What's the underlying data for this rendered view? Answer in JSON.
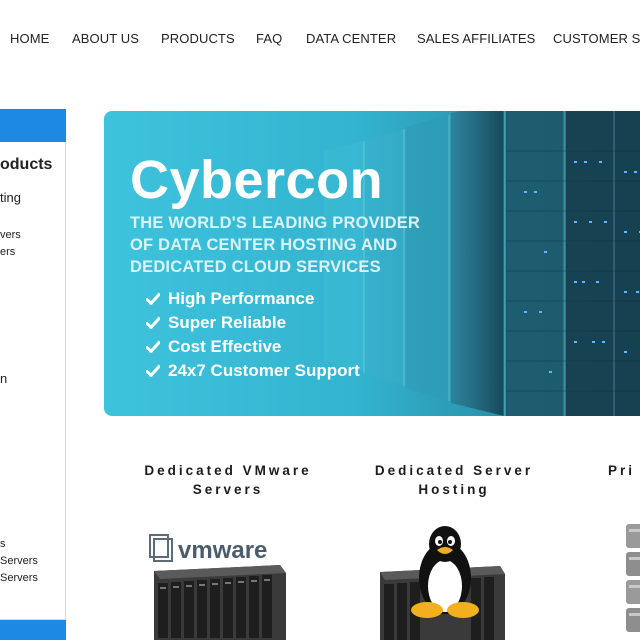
{
  "nav": {
    "items": [
      "HOME",
      "ABOUT US",
      "PRODUCTS",
      "FAQ",
      "DATA CENTER",
      "SALES AFFILIATES",
      "CUSTOMER SU"
    ]
  },
  "sidebar": {
    "title": "oducts",
    "items": [
      "ting",
      "vers",
      "ers",
      "n",
      "s",
      "Servers",
      "Servers"
    ],
    "accent_color": "#1e88e5"
  },
  "hero": {
    "brand": "Cybercon",
    "tagline": "THE WORLD'S LEADING PROVIDER\nOF DATA CENTER  HOSTING AND\nDEDICATED CLOUD SERVICES",
    "features": [
      "High Performance",
      "Super Reliable",
      "Cost Effective",
      "24x7 Customer Support"
    ]
  },
  "products": [
    {
      "title": "Dedicated VMware\nServers",
      "logo_text": "vmware",
      "icon": "vmware-logo"
    },
    {
      "title": "Dedicated Server\nHosting",
      "icon": "linux-penguin-icon"
    },
    {
      "title": "Pri",
      "icon": "server-stack-icon"
    }
  ]
}
